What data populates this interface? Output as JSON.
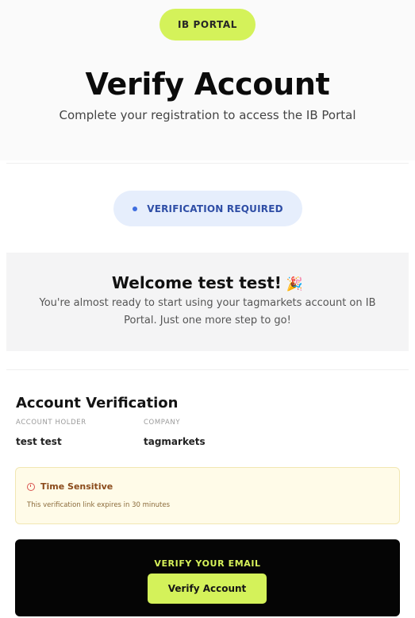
{
  "header": {
    "badge": "IB PORTAL",
    "title": "Verify Account",
    "subtitle": "Complete your registration to access the IB Portal"
  },
  "status": {
    "label": "VERIFICATION REQUIRED",
    "dot_color": "#3f6ee0"
  },
  "welcome": {
    "title": "Welcome test test!",
    "icon": "party-popper-icon",
    "message": "You're almost ready to start using your tagmarkets account on IB Portal. Just one more step to go!"
  },
  "account": {
    "section_title": "Account Verification",
    "holder_label": "ACCOUNT HOLDER",
    "holder_value": "test test",
    "company_label": "COMPANY",
    "company_value": "tagmarkets"
  },
  "alert": {
    "icon": "alarm-clock-icon",
    "title": "Time Sensitive",
    "message": "This verification link expires in 30 minutes"
  },
  "cta": {
    "label": "VERIFY YOUR EMAIL",
    "button": "Verify Account"
  },
  "colors": {
    "accent": "#d4f25a",
    "dark": "#050505",
    "status_bg": "#e6eefc",
    "alert_bg": "#fffbe8"
  }
}
